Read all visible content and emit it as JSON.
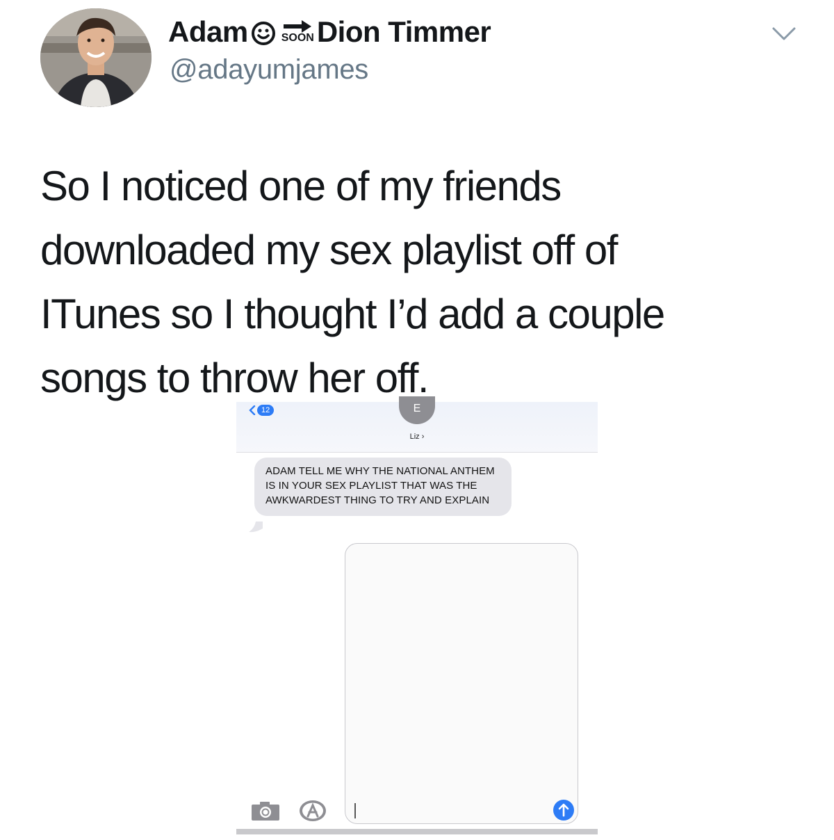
{
  "tweet": {
    "author": {
      "name_first": "Adam",
      "soon_label": "SOON",
      "name_second": "Dion Timmer",
      "handle": "@adayumjames",
      "avatar_icon": "profile-photo"
    },
    "menu_icon": "chevron-down-icon",
    "text": "So I noticed one of my friends\ndownloaded my sex playlist off of\nITunes so I thought I’d add a couple\nsongs to throw her off."
  },
  "attached_screenshot": {
    "header": {
      "back_count": "12",
      "contact_initial": "E",
      "contact_name": "Liz ›"
    },
    "message": {
      "text": "ADAM TELL ME WHY THE NATIONAL ANTHEM IS IN YOUR SEX PLAYLIST THAT WAS THE AWKWARDEST THING TO TRY AND EXPLAIN"
    },
    "compose": {
      "icons": [
        "camera-icon",
        "appstore-icon",
        "send-arrow-icon"
      ]
    },
    "colors": {
      "imessage_blue": "#2d7cf6",
      "received_bubble": "#e5e5ea"
    }
  },
  "colors": {
    "text_primary": "#14171a",
    "text_secondary": "#657786"
  }
}
